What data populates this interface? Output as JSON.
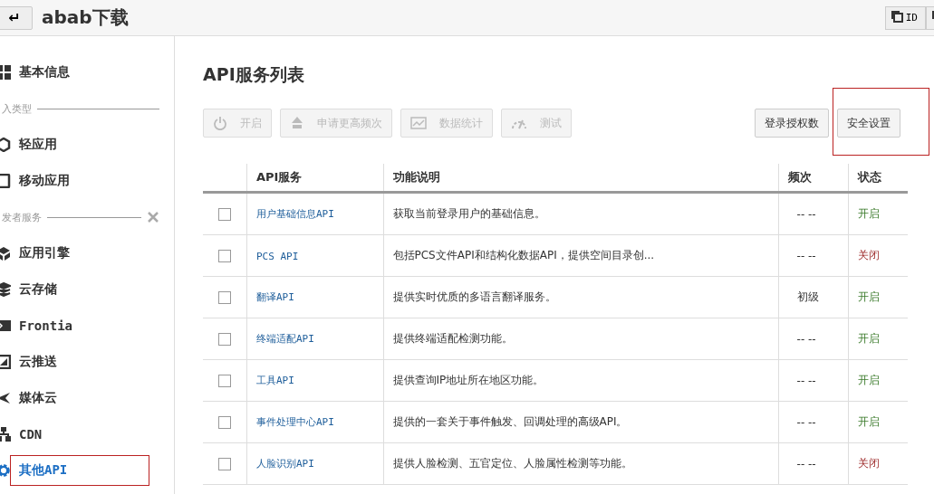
{
  "header": {
    "back": "↵",
    "title": "abab下载",
    "id_button": "ID"
  },
  "sidebar": {
    "items": [
      {
        "kind": "item",
        "label": "基本信息",
        "selected": false,
        "highlighted": false
      },
      {
        "kind": "section",
        "label": "入类型"
      },
      {
        "kind": "item",
        "label": "轻应用",
        "selected": false,
        "highlighted": false
      },
      {
        "kind": "item",
        "label": "移动应用",
        "selected": false,
        "highlighted": false
      },
      {
        "kind": "section",
        "label": "发者服务",
        "tool": true
      },
      {
        "kind": "item",
        "label": "应用引擎",
        "selected": false,
        "highlighted": false
      },
      {
        "kind": "item",
        "label": "云存储",
        "selected": false,
        "highlighted": false
      },
      {
        "kind": "item",
        "label": "Frontia",
        "selected": false,
        "highlighted": false
      },
      {
        "kind": "item",
        "label": "云推送",
        "selected": false,
        "highlighted": false
      },
      {
        "kind": "item",
        "label": "媒体云",
        "selected": false,
        "highlighted": false
      },
      {
        "kind": "item",
        "label": "CDN",
        "selected": false,
        "highlighted": false
      },
      {
        "kind": "item",
        "label": "其他API",
        "selected": true,
        "highlighted": true
      }
    ]
  },
  "main": {
    "title": "API服务列表",
    "toolbar": [
      {
        "label": "开启",
        "disabled": true,
        "highlighted": false
      },
      {
        "label": "申请更高频次",
        "disabled": true,
        "highlighted": false
      },
      {
        "label": "数据统计",
        "disabled": true,
        "highlighted": false
      },
      {
        "label": "测试",
        "disabled": true,
        "highlighted": false
      },
      {
        "label": "登录授权数",
        "disabled": false,
        "highlighted": false
      },
      {
        "label": "安全设置",
        "disabled": false,
        "highlighted": true
      }
    ],
    "table": {
      "columns": [
        "API服务",
        "功能说明",
        "频次",
        "状态"
      ],
      "rows": [
        {
          "checked": false,
          "name": "用户基础信息API",
          "desc": "获取当前登录用户的基础信息。",
          "freq": "-- --",
          "status": "开启",
          "enabled": true
        },
        {
          "checked": false,
          "name": "PCS API",
          "desc": "包括PCS文件API和结构化数据API，提供空间目录创...",
          "freq": "-- --",
          "status": "关闭",
          "enabled": false
        },
        {
          "checked": false,
          "name": "翻译API",
          "desc": "提供实时优质的多语言翻译服务。",
          "freq": "初级",
          "status": "开启",
          "enabled": true
        },
        {
          "checked": false,
          "name": "终端适配API",
          "desc": "提供终端适配检测功能。",
          "freq": "-- --",
          "status": "开启",
          "enabled": true
        },
        {
          "checked": false,
          "name": "工具API",
          "desc": "提供查询IP地址所在地区功能。",
          "freq": "-- --",
          "status": "开启",
          "enabled": true
        },
        {
          "checked": false,
          "name": "事件处理中心API",
          "desc": "提供的一套关于事件触发、回调处理的高级API。",
          "freq": "-- --",
          "status": "开启",
          "enabled": true
        },
        {
          "checked": false,
          "name": "人脸识别API",
          "desc": "提供人脸检测、五官定位、人脸属性检测等功能。",
          "freq": "-- --",
          "status": "关闭",
          "enabled": false
        }
      ]
    }
  }
}
